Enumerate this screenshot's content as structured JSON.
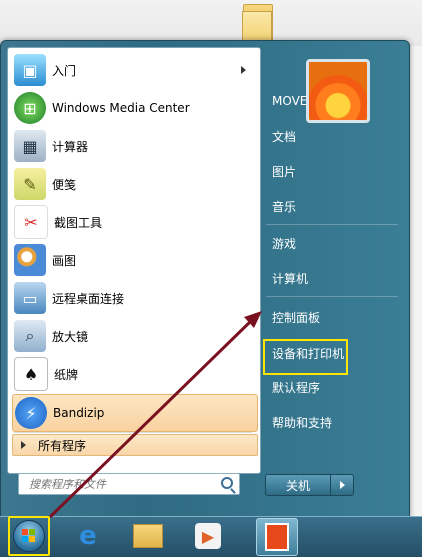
{
  "left_menu": {
    "items": [
      {
        "label": "入门",
        "icon": "getting-started-icon",
        "submenu": true
      },
      {
        "label": "Windows Media Center",
        "icon": "media-center-icon"
      },
      {
        "label": "计算器",
        "icon": "calculator-icon"
      },
      {
        "label": "便笺",
        "icon": "sticky-notes-icon"
      },
      {
        "label": "截图工具",
        "icon": "snipping-tool-icon"
      },
      {
        "label": "画图",
        "icon": "paint-icon"
      },
      {
        "label": "远程桌面连接",
        "icon": "remote-desktop-icon"
      },
      {
        "label": "放大镜",
        "icon": "magnifier-icon"
      },
      {
        "label": "纸牌",
        "icon": "solitaire-icon"
      },
      {
        "label": "Bandizip",
        "icon": "bandizip-icon",
        "highlighted": true
      }
    ],
    "all_programs": "所有程序"
  },
  "search": {
    "placeholder": "搜索程序和文件"
  },
  "right_menu": {
    "items": [
      {
        "label": "MOVE"
      },
      {
        "label": "文档"
      },
      {
        "label": "图片"
      },
      {
        "label": "音乐"
      },
      {
        "label": "游戏"
      },
      {
        "label": "计算机"
      },
      {
        "label": "控制面板",
        "highlighted_box": true
      },
      {
        "label": "设备和打印机"
      },
      {
        "label": "默认程序"
      },
      {
        "label": "帮助和支持"
      }
    ],
    "shutdown_label": "关机"
  },
  "taskbar": {
    "apps": [
      "internet-explorer-icon",
      "file-explorer-icon",
      "media-player-icon",
      "office-icon"
    ]
  },
  "colors": {
    "highlight_box": "#ffe600",
    "annotation_arrow": "#7a1020"
  }
}
